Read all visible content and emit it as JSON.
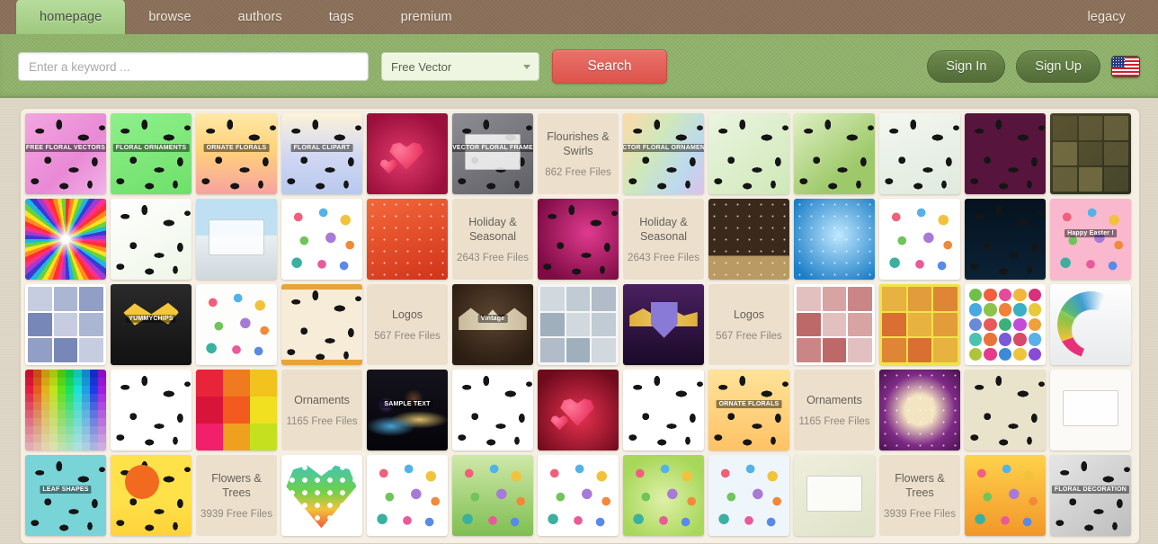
{
  "nav": {
    "tabs": [
      {
        "label": "homepage",
        "active": true
      },
      {
        "label": "browse",
        "active": false
      },
      {
        "label": "authors",
        "active": false
      },
      {
        "label": "tags",
        "active": false
      },
      {
        "label": "premium",
        "active": false
      }
    ],
    "legacy_label": "legacy"
  },
  "search": {
    "placeholder": "Enter a keyword ...",
    "value": "",
    "category_selected": "Free Vector",
    "button_label": "Search"
  },
  "account": {
    "sign_in_label": "Sign In",
    "sign_up_label": "Sign Up",
    "language_flag": "us-flag-icon"
  },
  "colors": {
    "nav_brown": "#8a7059",
    "band_green": "#8fb26a",
    "active_tab_green": "#a3cd86",
    "search_red": "#e3615a",
    "auth_green": "#5f7a42",
    "panel_cream": "#f6efe4",
    "category_tile": "#ece0cd"
  },
  "grid": {
    "columns": 14,
    "rows": 5,
    "cells": [
      {
        "type": "thumb",
        "name": "free-floral-vectors",
        "caption": "FREE FLORAL VECTORS",
        "bg": "pink-floral"
      },
      {
        "type": "thumb",
        "name": "floral-ornaments",
        "caption": "FLORAL ORNAMENTS",
        "bg": "green-floral"
      },
      {
        "type": "thumb",
        "name": "ornate-florals",
        "caption": "ORNATE FLORALS",
        "bg": "warm-gradient-floral"
      },
      {
        "type": "thumb",
        "name": "floral-clipart",
        "caption": "FLORAL CLIPART",
        "bg": "pastel-floral"
      },
      {
        "type": "thumb",
        "name": "pink-hearts-background",
        "caption": "",
        "bg": "crimson-hearts"
      },
      {
        "type": "thumb",
        "name": "vector-floral-frame",
        "caption": "VECTOR FLORAL FRAME",
        "bg": "grey-frame"
      },
      {
        "type": "cat",
        "name": "flourishes-and-swirls",
        "title": "Flourishes & Swirls",
        "count": "862 Free Files"
      },
      {
        "type": "thumb",
        "name": "vector-floral-ornaments",
        "caption": "VECTOR FLORAL ORNAMENTS",
        "bg": "rainbow-floral"
      },
      {
        "type": "thumb",
        "name": "green-swirl-background",
        "caption": "",
        "bg": "light-green-swirl"
      },
      {
        "type": "thumb",
        "name": "green-grunge-floral",
        "caption": "",
        "bg": "green-grunge"
      },
      {
        "type": "thumb",
        "name": "bird-branch-illustration",
        "caption": "",
        "bg": "pale-bird"
      },
      {
        "type": "thumb",
        "name": "purple-damask-pattern",
        "caption": "",
        "bg": "purple-damask"
      },
      {
        "type": "thumb",
        "name": "vintage-frames-collage",
        "caption": "",
        "bg": "dark-vintage-collage"
      },
      {
        "type": "thumb",
        "name": "rainbow-sunburst",
        "caption": "",
        "bg": "rainbow-burst"
      },
      {
        "type": "thumb",
        "name": "green-leaf-swirl",
        "caption": "",
        "bg": "white-green-swirl"
      },
      {
        "type": "thumb",
        "name": "paper-curl-landscape",
        "caption": "",
        "bg": "sky-paper"
      },
      {
        "type": "thumb",
        "name": "christmas-doodles",
        "caption": "",
        "bg": "white-doodles"
      },
      {
        "type": "thumb",
        "name": "merry-christmas-orange",
        "caption": "",
        "bg": "orange-xmas"
      },
      {
        "type": "cat",
        "name": "holiday-and-seasonal-left",
        "title": "Holiday & Seasonal",
        "count": "2643 Free Files"
      },
      {
        "type": "thumb",
        "name": "valentines-swirl-pink",
        "caption": "",
        "bg": "magenta-swirl"
      },
      {
        "type": "cat",
        "name": "holiday-and-seasonal-right",
        "title": "Holiday & Seasonal",
        "count": "2643 Free Files"
      },
      {
        "type": "thumb",
        "name": "merry-christmas-brown",
        "caption": "",
        "bg": "brown-xmas"
      },
      {
        "type": "thumb",
        "name": "blue-snowflakes",
        "caption": "",
        "bg": "blue-snow"
      },
      {
        "type": "thumb",
        "name": "travel-icons-set",
        "caption": "",
        "bg": "white-travel"
      },
      {
        "type": "thumb",
        "name": "halloween-pumpkins",
        "caption": "",
        "bg": "dark-halloween"
      },
      {
        "type": "thumb",
        "name": "happy-easter-bunnies",
        "caption": "Happy Easter !",
        "bg": "pink-easter"
      },
      {
        "type": "thumb",
        "name": "myspace-social-logos",
        "caption": "",
        "bg": "white-social"
      },
      {
        "type": "thumb",
        "name": "yummy-chips-logo",
        "caption": "YUMMYCHIPS",
        "bg": "dark-yellow-logo"
      },
      {
        "type": "thumb",
        "name": "furniture-icons",
        "caption": "",
        "bg": "white-furniture"
      },
      {
        "type": "thumb",
        "name": "tribal-symbols-set",
        "caption": "",
        "bg": "cream-tribal"
      },
      {
        "type": "cat",
        "name": "logos-left",
        "title": "Logos",
        "count": "567 Free Files"
      },
      {
        "type": "thumb",
        "name": "vintage-wings-emblem",
        "caption": "Vintage",
        "bg": "brown-emblem"
      },
      {
        "type": "thumb",
        "name": "labels-badges-sheet",
        "caption": "",
        "bg": "white-labels"
      },
      {
        "type": "thumb",
        "name": "team-crest-logo",
        "caption": "",
        "bg": "purple-crest"
      },
      {
        "type": "cat",
        "name": "logos-right",
        "title": "Logos",
        "count": "567 Free Files"
      },
      {
        "type": "thumb",
        "name": "postage-stamps-set",
        "caption": "",
        "bg": "white-stamps"
      },
      {
        "type": "thumb",
        "name": "corporate-logo-sheet",
        "caption": "",
        "bg": "yellow-logos"
      },
      {
        "type": "thumb",
        "name": "colorful-icon-grid",
        "caption": "",
        "bg": "white-icon-grid"
      },
      {
        "type": "thumb",
        "name": "rainbow-arrow-swoosh",
        "caption": "",
        "bg": "white-swoosh"
      },
      {
        "type": "thumb",
        "name": "color-swatch-palette",
        "caption": "",
        "bg": "swatch-grid"
      },
      {
        "type": "thumb",
        "name": "black-floral-silhouettes",
        "caption": "",
        "bg": "white-black-floral"
      },
      {
        "type": "thumb",
        "name": "color-block-squares",
        "caption": "",
        "bg": "color-blocks"
      },
      {
        "type": "cat",
        "name": "ornaments-left",
        "title": "Ornaments",
        "count": "1165 Free Files"
      },
      {
        "type": "thumb",
        "name": "sample-text-wave",
        "caption": "SAMPLE TEXT",
        "bg": "dark-wave"
      },
      {
        "type": "thumb",
        "name": "white-damask-ornament",
        "caption": "",
        "bg": "white-damask"
      },
      {
        "type": "thumb",
        "name": "red-heart-swirl",
        "caption": "",
        "bg": "red-heart"
      },
      {
        "type": "thumb",
        "name": "white-floral-pattern",
        "caption": "",
        "bg": "white-floral-pattern"
      },
      {
        "type": "thumb",
        "name": "ornate-florals-yellow",
        "caption": "ORNATE FLORALS",
        "bg": "yellow-ornate"
      },
      {
        "type": "cat",
        "name": "ornaments-right",
        "title": "Ornaments",
        "count": "1165 Free Files"
      },
      {
        "type": "thumb",
        "name": "merry-christmas-purple",
        "caption": "",
        "bg": "purple-xmas"
      },
      {
        "type": "thumb",
        "name": "vintage-lace-pattern",
        "caption": "",
        "bg": "beige-lace"
      },
      {
        "type": "thumb",
        "name": "vintage-frame-label",
        "caption": "",
        "bg": "white-vintage-frame"
      },
      {
        "type": "thumb",
        "name": "leaf-shapes-set",
        "caption": "LEAF SHAPES",
        "bg": "teal-leaves"
      },
      {
        "type": "thumb",
        "name": "sunset-tree-silhouette",
        "caption": "",
        "bg": "yellow-tree"
      },
      {
        "type": "cat",
        "name": "flowers-and-trees-left",
        "title": "Flowers & Trees",
        "count": "3939 Free Files"
      },
      {
        "type": "thumb",
        "name": "flower-heart-rainbow",
        "caption": "",
        "bg": "flower-heart"
      },
      {
        "type": "thumb",
        "name": "colorful-flowers-splash",
        "caption": "",
        "bg": "splash-flowers"
      },
      {
        "type": "thumb",
        "name": "butterfly-green-nature",
        "caption": "",
        "bg": "green-butterfly"
      },
      {
        "type": "thumb",
        "name": "plants-pots-icons",
        "caption": "",
        "bg": "white-plants"
      },
      {
        "type": "thumb",
        "name": "watercolor-flowers",
        "caption": "",
        "bg": "watercolor-green"
      },
      {
        "type": "thumb",
        "name": "blue-flower-pattern",
        "caption": "",
        "bg": "blue-flowers"
      },
      {
        "type": "thumb",
        "name": "vintage-floral-card",
        "caption": "",
        "bg": "vintage-card"
      },
      {
        "type": "cat",
        "name": "flowers-and-trees-right",
        "title": "Flowers & Trees",
        "count": "3939 Free Files"
      },
      {
        "type": "thumb",
        "name": "autumn-kids-illustration",
        "caption": "",
        "bg": "autumn-kids"
      },
      {
        "type": "thumb",
        "name": "floral-decoration-grey",
        "caption": "FLORAL DECORATION",
        "bg": "grey-floral-deco"
      }
    ]
  }
}
